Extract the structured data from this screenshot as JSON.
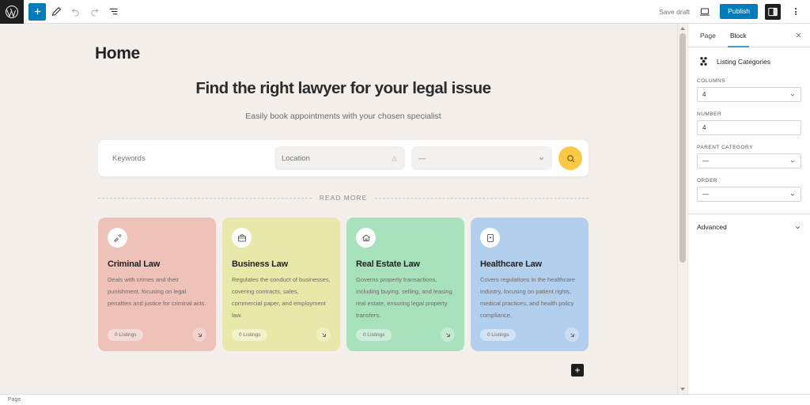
{
  "topbar": {
    "logo_icon": "wordpress-logo-icon",
    "left_tools": [
      {
        "name": "add-block-button",
        "icon": "plus-icon",
        "primary": true
      },
      {
        "name": "tools-button",
        "icon": "pencil-icon",
        "primary": false
      },
      {
        "name": "undo-button",
        "icon": "undo-icon",
        "primary": false
      },
      {
        "name": "redo-button",
        "icon": "redo-icon",
        "primary": false
      },
      {
        "name": "list-view-button",
        "icon": "list-view-icon",
        "primary": false
      }
    ],
    "save_draft_label": "Save draft",
    "preview_icon": "preview-laptop-icon",
    "publish_label": "Publish",
    "settings_icon": "settings-sidebar-icon",
    "options_icon": "kebab-menu-icon",
    "accent_color": "#007cba"
  },
  "canvas": {
    "page_title": "Home",
    "hero": {
      "heading": "Find the right lawyer for your legal issue",
      "subheading": "Easily book appointments with your chosen specialist"
    },
    "search": {
      "keywords_placeholder": "Keywords",
      "location_placeholder": "Location",
      "location_icon": "map-pin-icon",
      "category_value": "—",
      "category_chevron_icon": "chevron-down-icon",
      "submit_icon": "search-icon",
      "submit_color": "#fcc945"
    },
    "divider_label": "READ MORE",
    "cards": [
      {
        "title": "Criminal Law",
        "description": "Deals with crimes and their punishment, focusing on legal penalties and justice for criminal acts.",
        "badge": "0 Listings",
        "icon": "gavel-icon",
        "color": "#eec1b9",
        "arrow_icon": "arrow-down-right-icon"
      },
      {
        "title": "Business Law",
        "description": "Regulates the conduct of businesses, covering contracts, sales, commercial paper, and employment law.",
        "badge": "0 Listings",
        "icon": "briefcase-icon",
        "color": "#e8e9a8",
        "arrow_icon": "arrow-down-right-icon"
      },
      {
        "title": "Real Estate Law",
        "description": "Governs property transactions, including buying, selling, and leasing real estate, ensuring legal property transfers.",
        "badge": "0 Listings",
        "icon": "home-icon",
        "color": "#a8e2bd",
        "arrow_icon": "arrow-down-right-icon"
      },
      {
        "title": "Healthcare Law",
        "description": "Covers regulations in the healthcare industry, focusing on patient rights, medical practices, and health policy compliance.",
        "badge": "0 Listings",
        "icon": "medical-book-icon",
        "color": "#b3cfee",
        "arrow_icon": "arrow-down-right-icon"
      }
    ],
    "appender_icon": "plus-icon",
    "background_color": "#f5efeb"
  },
  "sidebar": {
    "tabs": [
      {
        "label": "Page",
        "active": false
      },
      {
        "label": "Block",
        "active": true
      }
    ],
    "close_icon": "close-icon",
    "block": {
      "icon": "listing-categories-icon",
      "name": "Listing Categories"
    },
    "fields": [
      {
        "label": "COLUMNS",
        "value": "4",
        "type": "select",
        "chevron": "chevron-down-icon"
      },
      {
        "label": "NUMBER",
        "value": "4",
        "type": "text",
        "chevron": ""
      },
      {
        "label": "PARENT CATEGORY",
        "value": "—",
        "type": "select",
        "chevron": "chevron-down-icon"
      },
      {
        "label": "ORDER",
        "value": "—",
        "type": "select",
        "chevron": "chevron-down-icon"
      }
    ],
    "advanced_label": "Advanced",
    "advanced_icon": "chevron-down-icon",
    "active_tab_color": "#4a9cc7"
  },
  "statusbar": {
    "label": "Page"
  }
}
